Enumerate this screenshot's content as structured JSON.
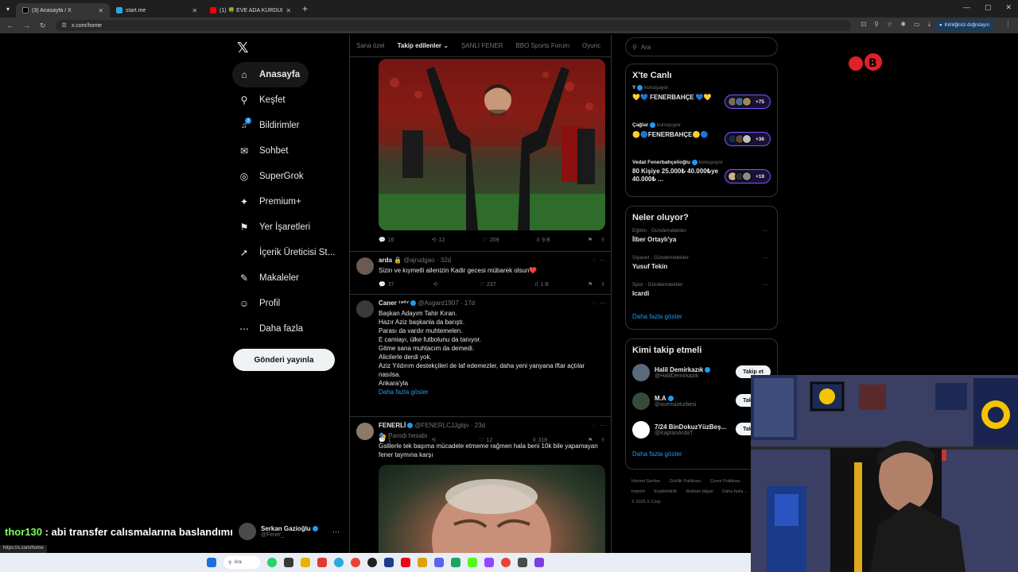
{
  "browser": {
    "tabs": [
      {
        "label": "(3) Anasayfa / X",
        "color": "#000000",
        "active": true
      },
      {
        "label": "start.me",
        "color": "#2aa8e0",
        "active": false
      },
      {
        "label": "(1) 🍀 EVE ADA KURDUM 🍀 F",
        "color": "#ff0000",
        "active": false
      }
    ],
    "url": "x.com/home",
    "verify_label": "Kimliğinizi doğrulayın",
    "status_url": "https://x.com/home"
  },
  "sidebar": {
    "logo": "𝕏",
    "items": [
      {
        "label": "Anasayfa",
        "icon": "home-icon",
        "glyph": "⌂"
      },
      {
        "label": "Keşfet",
        "icon": "search-icon",
        "glyph": "⚲"
      },
      {
        "label": "Bildirimler",
        "icon": "bell-icon",
        "glyph": "🔔",
        "badge": "3"
      },
      {
        "label": "Sohbet",
        "icon": "mail-icon",
        "glyph": "✉"
      },
      {
        "label": "SuperGrok",
        "icon": "grok-icon",
        "glyph": "◎"
      },
      {
        "label": "Premium+",
        "icon": "premium-icon",
        "glyph": "✦"
      },
      {
        "label": "Yer İşaretleri",
        "icon": "bookmark-icon",
        "glyph": "⚑"
      },
      {
        "label": "İçerik Üreticisi St...",
        "icon": "rocket-icon",
        "glyph": "➚"
      },
      {
        "label": "Makaleler",
        "icon": "article-icon",
        "glyph": "✎"
      },
      {
        "label": "Profil",
        "icon": "person-icon",
        "glyph": "☺"
      },
      {
        "label": "Daha fazla",
        "icon": "more-circle-icon",
        "glyph": "⋯"
      }
    ],
    "post_button": "Gönderi yayınla",
    "profile": {
      "name": "Serkan Gazioğlu",
      "handle": "@Fener_"
    }
  },
  "chat_overlay": {
    "user": "thor130",
    "message": " : abi transfer calısmalarına baslandımı"
  },
  "timeline": {
    "tabs": [
      "Sana özel",
      "Takip edilenler",
      "ŞANLI FENER",
      "BBO Sports Forum",
      "Oyunc"
    ],
    "active_tab": "Takip edilenler",
    "post1_stats": {
      "replies": "16",
      "reposts": "12",
      "likes": "209",
      "views": "9 B"
    },
    "tweets": [
      {
        "name": "arda 🔒",
        "handle": "@ajrudgao · 32d",
        "text": "Sizin ve kıymetli ailenizin Kadir gecesi mübarek olsun❤️",
        "stats": {
          "replies": "37",
          "reposts": "",
          "likes": "237",
          "views": "1 B"
        }
      },
      {
        "name": "Caner ¹⁹⁰⁷",
        "handle": "@Asgard1907 · 17d",
        "lines": [
          "Başkan Adayım Tahir Kıran.",
          "Hazır Aziz başkanla da barıştı.",
          "Parası da vardır muhtemelen.",
          "E camiayı, ülke futbolunu da tanıyor.",
          "Gitme sana muhtacım da demedi.",
          "Alicilerle derdi yok.",
          "Aziz Yıldırım destekçileri de laf edemezler, daha yeni yanyana iftar açtılar nasılsa.",
          "Ankara'yla"
        ],
        "show_more": "Daha fazla göster",
        "stats": {
          "replies": "1",
          "reposts": "",
          "likes": "12",
          "views": "318"
        }
      },
      {
        "name": "FENERLİ",
        "handle": "@FENERLCJJglqv · 23d",
        "parody": "🎭 Parodi hesabı",
        "text": "Gslilerle tek başıma mücadele etmeme rağmen hala beni 10k bile yapamayan fener taymına karşı"
      }
    ]
  },
  "right": {
    "search_placeholder": "Ara",
    "live": {
      "title": "X'te Canlı",
      "items": [
        {
          "user": "Y",
          "status": "konuşuyor",
          "title": "💛💙 FENERBAHÇE 💙💛",
          "count": "+75"
        },
        {
          "user": "Çağlar",
          "status": "konuşuyor",
          "title": "🟡🔵FENERBAHÇE🟡🔵",
          "count": "+36"
        },
        {
          "user": "Vedat Fenerbahçelioğlu",
          "status": "konuşuyor",
          "title": "80 Kişiye 25.000₺ 40.000₺ye 40.000₺ ...",
          "count": "+19"
        }
      ]
    },
    "trends": {
      "title": "Neler oluyor?",
      "items": [
        {
          "ctx": "Eğitim · Gündemdekiler",
          "name": "İlber Ortaylı'ya"
        },
        {
          "ctx": "Siyaset · Gündemdekiler",
          "name": "Yusuf Tekin"
        },
        {
          "ctx": "Spor · Gündemdekiler",
          "name": "Icardi"
        }
      ],
      "show_more": "Daha fazla göster"
    },
    "follow": {
      "title": "Kimi takip etmeli",
      "button": "Takip et",
      "items": [
        {
          "name": "Halil Demirkazık",
          "handle": "@HalilDemirkazik",
          "color": "#5a6a7a"
        },
        {
          "name": "M.A",
          "handle": "@asensioturbesi",
          "color": "#3a4a3a"
        },
        {
          "name": "7/24 BinDokuzYüzBeş...",
          "handle": "@KaptanArdaT",
          "color": "#ffffff"
        }
      ],
      "show_more": "Daha fazla göster"
    },
    "footer": [
      "Hizmet Şartları",
      "Gizlilik Politikası",
      "Çerez Politikası",
      "Imprint",
      "Erişilebilirlik",
      "Reklam bilgisi",
      "Daha fazla ...",
      "© 2025 X Corp."
    ]
  },
  "taskbar": {
    "search": "Ara"
  }
}
